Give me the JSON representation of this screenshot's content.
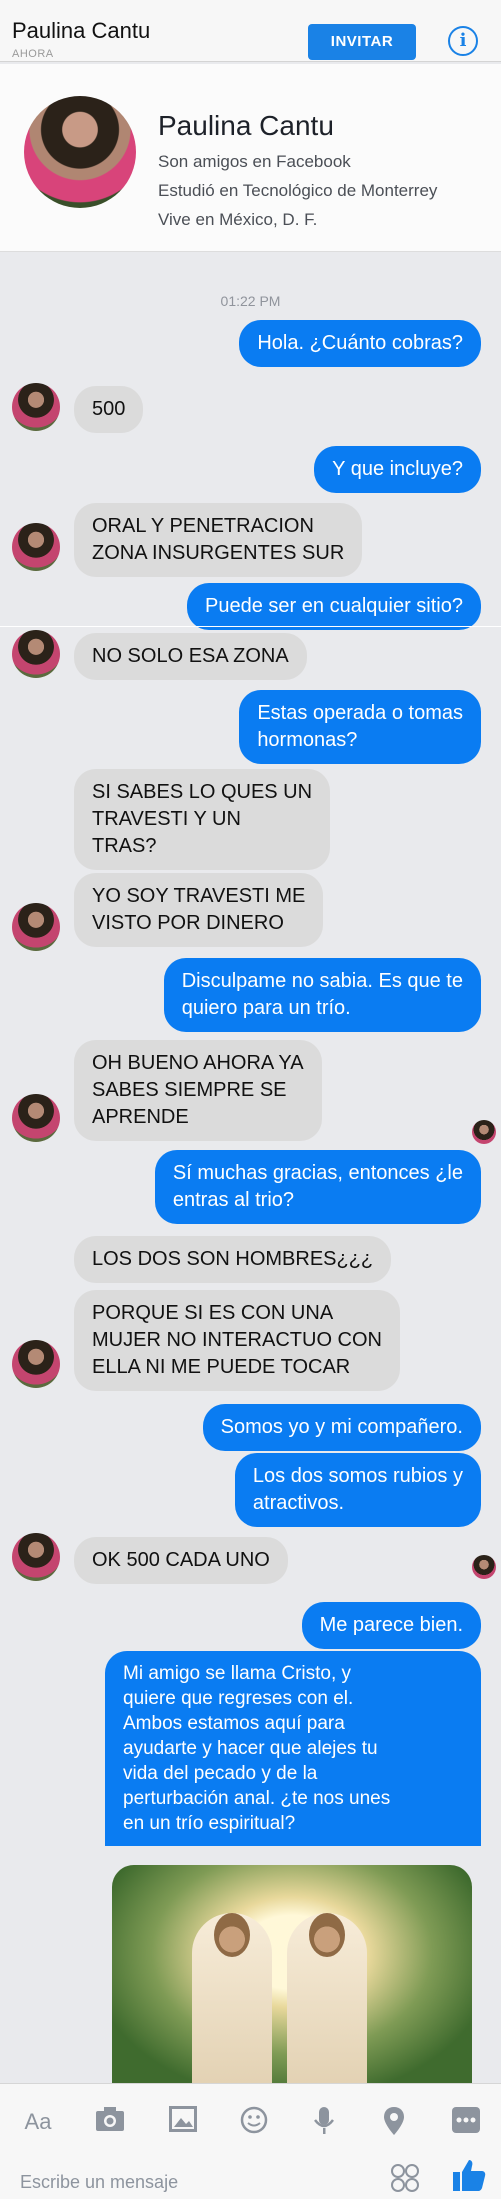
{
  "header": {
    "title": "Paulina Cantu",
    "status": "AHORA",
    "invite_label": "INVITAR",
    "info_icon": "i"
  },
  "profile": {
    "name": "Paulina Cantu",
    "line1": "Son amigos en Facebook",
    "line2": "Estudió en Tecnológico de Monterrey",
    "line3": "Vive en México, D. F."
  },
  "timestamp": "01:22 PM",
  "messages": [
    "Hola. ¿Cuánto cobras?",
    "500",
    "Y que incluye?",
    "ORAL Y PENETRACION\nZONA INSURGENTES SUR",
    "Puede ser en cualquier sitio?",
    "NO SOLO ESA ZONA",
    "Estas operada o tomas\nhormonas?",
    "SI SABES LO QUES UN\nTRAVESTI Y UN\nTRAS?",
    "YO SOY TRAVESTI ME\nVISTO POR DINERO",
    "Disculpame no sabia. Es que te\nquiero para un trío.",
    "OH BUENO AHORA YA\nSABES SIEMPRE SE\nAPRENDE",
    "Sí muchas gracias, entonces ¿le\nentras al trio?",
    "LOS DOS SON HOMBRES¿¿¿",
    "PORQUE SI ES CON UNA\nMUJER NO INTERACTUO CON\nELLA NI ME PUEDE TOCAR",
    "Somos yo y mi compañero.",
    "Los dos somos rubios y\natractivos.",
    "OK 500 CADA UNO",
    "Me parece bien.",
    "Mi amigo se llama Cristo, y\nquiere que regreses con el.\nAmbos estamos aquí para\nayudarte y hacer que alejes tu\nvida del pecado y de la\nperturbación anal. ¿te nos unes\nen un trío espiritual?"
  ],
  "composer": {
    "text_icon": "Aa",
    "placeholder": "Escribe un mensaje",
    "icons": [
      "camera-icon",
      "image-icon",
      "sticker-icon",
      "microphone-icon",
      "location-icon",
      "more-icon",
      "emoji-icon",
      "like-icon"
    ]
  }
}
